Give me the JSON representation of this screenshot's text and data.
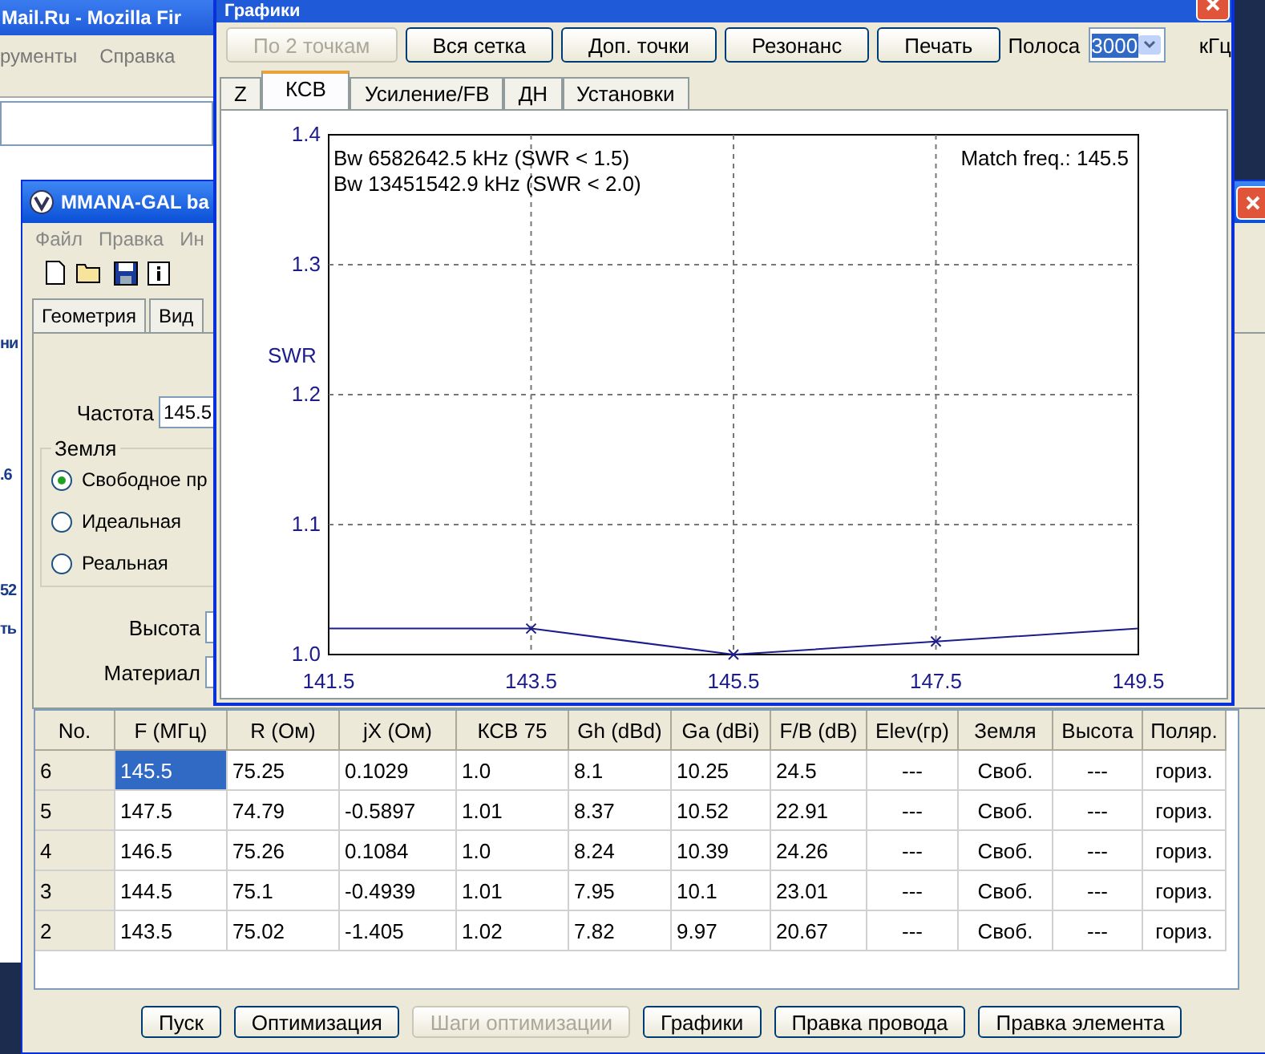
{
  "browser_window": {
    "title": "Mail.Ru - Mozilla Fir",
    "menu": [
      "рументы",
      "Справка"
    ],
    "side_fragments": [
      "ни",
      ".6",
      "52",
      "ть"
    ]
  },
  "main_window": {
    "title": "MMANA-GAL ba",
    "menu": [
      "Файл",
      "Правка",
      "Ин"
    ],
    "toolbar": [
      {
        "kind": "new"
      },
      {
        "kind": "open"
      },
      {
        "kind": "save"
      },
      {
        "kind": "info"
      }
    ],
    "tabs": [
      {
        "label": "Геометрия",
        "selected": false
      },
      {
        "label": "Вид",
        "selected": false
      }
    ],
    "frequency": {
      "label": "Частота",
      "value": "145.5"
    },
    "ground": {
      "title": "Земля",
      "options": [
        {
          "label": "Свободное пр",
          "selected": true
        },
        {
          "label": "Идеальная",
          "selected": false
        },
        {
          "label": "Реальная",
          "selected": false
        }
      ]
    },
    "height_label": "Высота",
    "material_label": "Материал",
    "table": {
      "columns": [
        "No.",
        "F (МГц)",
        "R (Ом)",
        "jX (Ом)",
        "КСВ 75",
        "Gh (dBd)",
        "Ga (dBi)",
        "F/B (dB)",
        "Elev(гр)",
        "Земля",
        "Высота",
        "Поляр."
      ],
      "rows": [
        {
          "selected": true,
          "cells": [
            "6",
            "145.5",
            "75.25",
            "0.1029",
            "1.0",
            "8.1",
            "10.25",
            "24.5",
            "---",
            "Своб.",
            "---",
            "гориз."
          ]
        },
        {
          "selected": false,
          "cells": [
            "5",
            "147.5",
            "74.79",
            "-0.5897",
            "1.01",
            "8.37",
            "10.52",
            "22.91",
            "---",
            "Своб.",
            "---",
            "гориз."
          ]
        },
        {
          "selected": false,
          "cells": [
            "4",
            "146.5",
            "75.26",
            "0.1084",
            "1.0",
            "8.24",
            "10.39",
            "24.26",
            "---",
            "Своб.",
            "---",
            "гориз."
          ]
        },
        {
          "selected": false,
          "cells": [
            "3",
            "144.5",
            "75.1",
            "-0.4939",
            "1.01",
            "7.95",
            "10.1",
            "23.01",
            "---",
            "Своб.",
            "---",
            "гориз."
          ]
        },
        {
          "selected": false,
          "cells": [
            "2",
            "143.5",
            "75.02",
            "-1.405",
            "1.02",
            "7.82",
            "9.97",
            "20.67",
            "---",
            "Своб.",
            "---",
            "гориз."
          ]
        }
      ]
    },
    "buttons": [
      {
        "label": "Пуск",
        "disabled": false
      },
      {
        "label": "Оптимизация",
        "disabled": false
      },
      {
        "label": "Шаги оптимизации",
        "disabled": true
      },
      {
        "label": "Графики",
        "disabled": false
      },
      {
        "label": "Правка провода",
        "disabled": false
      },
      {
        "label": "Правка элемента",
        "disabled": false
      }
    ]
  },
  "graphs_window": {
    "title": "Графики",
    "buttons": [
      {
        "label": "По 2 точкам",
        "disabled": true
      },
      {
        "label": "Вся сетка",
        "disabled": false
      },
      {
        "label": "Доп. точки",
        "disabled": false
      },
      {
        "label": "Резонанс",
        "disabled": false
      },
      {
        "label": "Печать",
        "disabled": false
      }
    ],
    "band": {
      "label": "Полоса",
      "value": "3000",
      "unit": "кГц"
    },
    "tabs": [
      {
        "label": "Z",
        "selected": false
      },
      {
        "label": "КСВ",
        "selected": true
      },
      {
        "label": "Усиление/FB",
        "selected": false
      },
      {
        "label": "ДН",
        "selected": false
      },
      {
        "label": "Установки",
        "selected": false
      }
    ],
    "chart_data": {
      "type": "line",
      "ylabel": "SWR",
      "x": [
        141.5,
        143.5,
        145.5,
        147.5,
        149.5
      ],
      "series": [
        {
          "color": "#1c1c8c",
          "values": [
            1.02,
            1.02,
            1.0,
            1.01,
            1.02
          ]
        }
      ],
      "grid": true,
      "xlim": [
        141.5,
        149.5
      ],
      "ylim": [
        1.0,
        1.4
      ],
      "xticks": [
        {
          "value": 141.5,
          "label": "141.5"
        },
        {
          "value": 143.5,
          "label": "143.5"
        },
        {
          "value": 145.5,
          "label": "145.5"
        },
        {
          "value": 147.5,
          "label": "147.5"
        },
        {
          "value": 149.5,
          "label": "149.5"
        }
      ],
      "yticks": [
        {
          "value": 1.0,
          "label": "1.0"
        },
        {
          "value": 1.1,
          "label": "1.1"
        },
        {
          "value": 1.2,
          "label": "1.2"
        },
        {
          "value": 1.3,
          "label": "1.3"
        },
        {
          "value": 1.4,
          "label": "1.4"
        }
      ],
      "annotations": [
        "Bw 6582642.5 kHz (SWR < 1.5)",
        "Bw 13451542.9 kHz (SWR < 2.0)",
        "Match freq.: 145.5"
      ]
    }
  }
}
